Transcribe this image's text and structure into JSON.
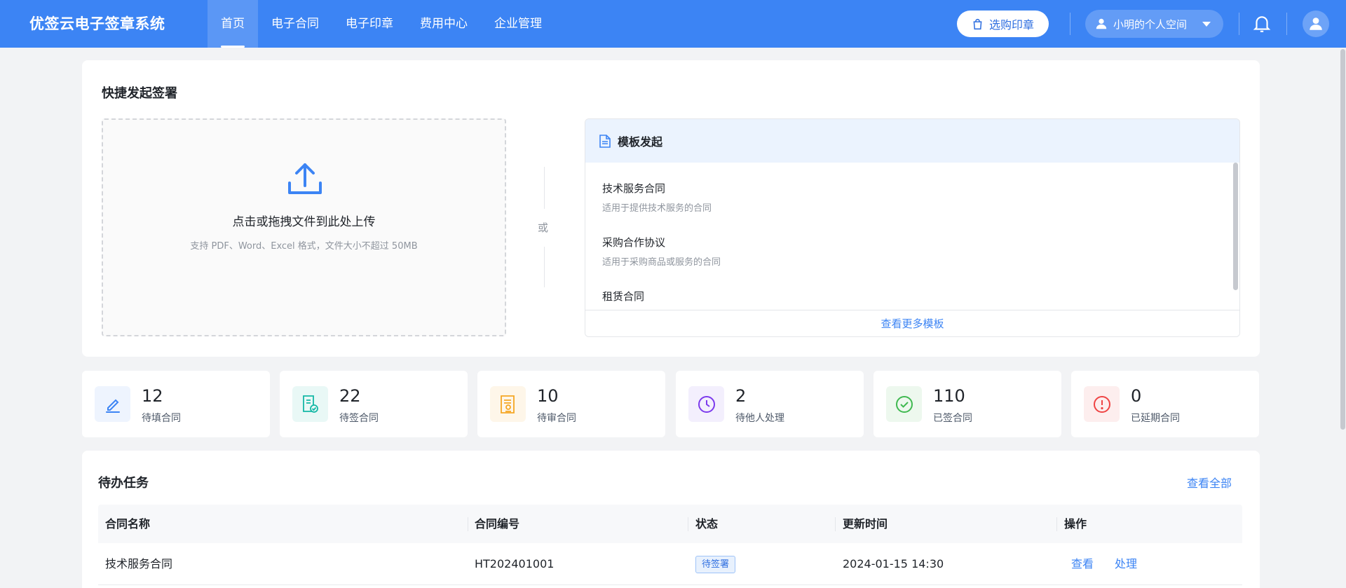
{
  "header": {
    "brand": "优签云电子签章系统",
    "nav": [
      {
        "label": "首页",
        "active": true
      },
      {
        "label": "电子合同",
        "active": false
      },
      {
        "label": "电子印章",
        "active": false
      },
      {
        "label": "费用中心",
        "active": false
      },
      {
        "label": "企业管理",
        "active": false
      }
    ],
    "buy_label": "选购印章",
    "space_label": "小明的个人空间",
    "accent": "#3c84f4"
  },
  "quick": {
    "title": "快捷发起签署",
    "upload_main": "点击或拖拽文件到此处上传",
    "upload_sub": "支持 PDF、Word、Excel 格式，文件大小不超过 50MB",
    "or_text": "或",
    "template_title": "模板发起",
    "templates": [
      {
        "name": "技术服务合同",
        "desc": "适用于提供技术服务的合同"
      },
      {
        "name": "采购合作协议",
        "desc": "适用于采购商品或服务的合同"
      },
      {
        "name": "租赁合同",
        "desc": ""
      }
    ],
    "more_templates": "查看更多模板"
  },
  "stats": [
    {
      "value": "12",
      "label": "待填合同",
      "color": "#3c84f4",
      "bg": "#eef4fe",
      "icon": "pen-icon"
    },
    {
      "value": "22",
      "label": "待签合同",
      "color": "#14b8a6",
      "bg": "#e9f8f6",
      "icon": "sign-doc-icon"
    },
    {
      "value": "10",
      "label": "待审合同",
      "color": "#f5a623",
      "bg": "#fef6e9",
      "icon": "review-doc-icon"
    },
    {
      "value": "2",
      "label": "待他人处理",
      "color": "#7c3aed",
      "bg": "#f3effd",
      "icon": "clock-icon"
    },
    {
      "value": "110",
      "label": "已签合同",
      "color": "#3fb950",
      "bg": "#edf8ee",
      "icon": "check-circle-icon"
    },
    {
      "value": "0",
      "label": "已延期合同",
      "color": "#ef4444",
      "bg": "#fdeeee",
      "icon": "alert-circle-icon"
    }
  ],
  "todo": {
    "title": "待办任务",
    "view_all": "查看全部",
    "columns": [
      "合同名称",
      "合同编号",
      "状态",
      "更新时间",
      "操作"
    ],
    "rows": [
      {
        "name": "技术服务合同",
        "code": "HT202401001",
        "status": "待签署",
        "time": "2024-01-15 14:30",
        "ops": [
          "查看",
          "处理"
        ]
      }
    ]
  }
}
